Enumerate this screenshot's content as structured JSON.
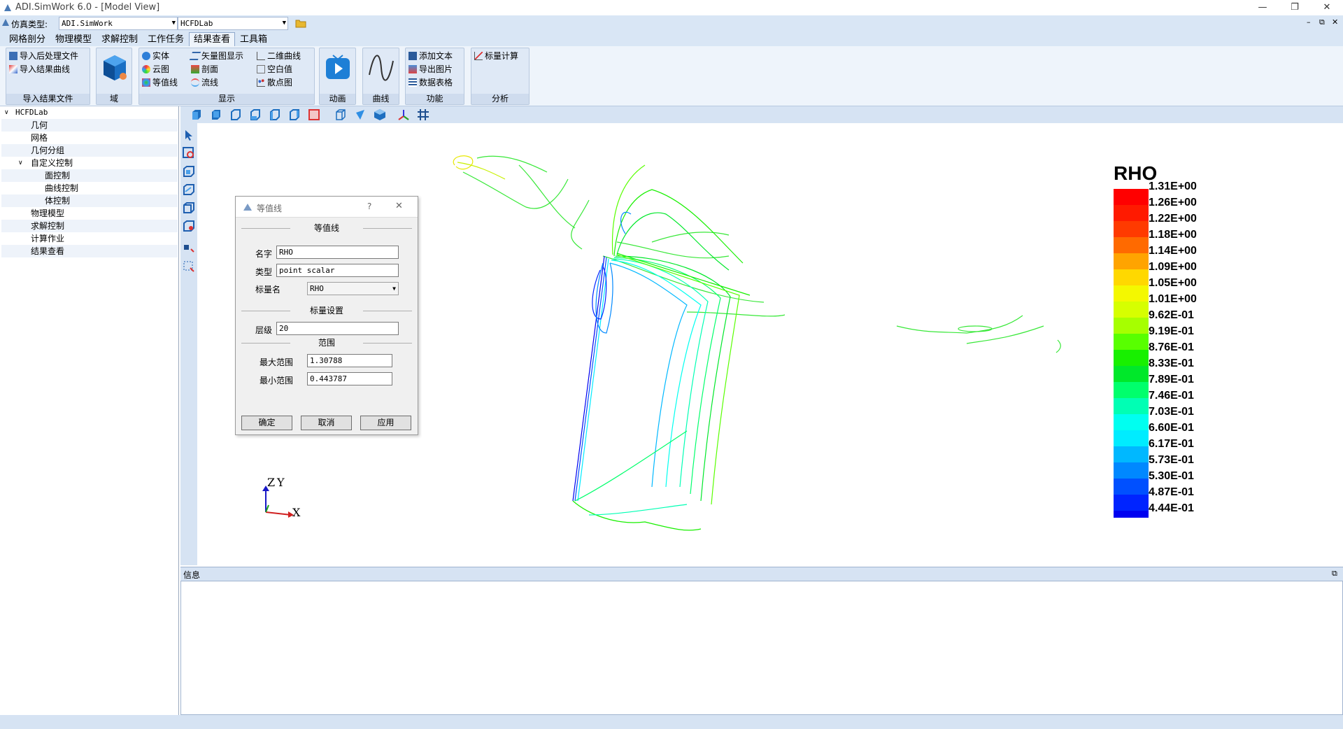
{
  "window": {
    "title": "ADI.SimWork 6.0 - [Model View]",
    "minimize": "—",
    "restore": "❐",
    "close": "✕",
    "sub_min": "–",
    "sub_restore": "⧉",
    "sub_close": "✕"
  },
  "sim_row": {
    "label": "仿真类型:",
    "type_value": "ADI.SimWork",
    "case_value": "HCFDLab"
  },
  "menu_tabs": [
    "网格剖分",
    "物理模型",
    "求解控制",
    "工作任务",
    "结果查看",
    "工具箱"
  ],
  "ribbon": {
    "import_group": {
      "label": "导入结果文件",
      "items": [
        "导入后处理文件",
        "导入结果曲线"
      ]
    },
    "domain_group": {
      "label": "域"
    },
    "display_group": {
      "label": "显示",
      "items": [
        "实体",
        "云图",
        "等值线",
        "矢量图显示",
        "剖面",
        "流线",
        "二维曲线",
        "空白值",
        "散点图"
      ]
    },
    "animation_group": {
      "label": "动画"
    },
    "curve_group": {
      "label": "曲线"
    },
    "function_group": {
      "label": "功能",
      "items": [
        "添加文本",
        "导出图片",
        "数据表格"
      ]
    },
    "analysis_group": {
      "label": "分析",
      "items": [
        "标量计算"
      ]
    }
  },
  "tree": {
    "root": "HCFDLab",
    "items": [
      "几何",
      "网格",
      "几何分组",
      "自定义控制",
      "面控制",
      "曲线控制",
      "体控制",
      "物理模型",
      "求解控制",
      "计算作业",
      "结果查看"
    ]
  },
  "dialog": {
    "title": "等值线",
    "help": "?",
    "close": "✕",
    "section1": "等值线",
    "name_label": "名字",
    "name_value": "RHO",
    "type_label": "类型",
    "type_value": "point scalar",
    "scalar_label": "标量名",
    "scalar_value": "RHO",
    "section2": "标量设置",
    "level_label": "层级",
    "level_value": "20",
    "section3": "范围",
    "max_label": "最大范围",
    "max_value": "1.30788",
    "min_label": "最小范围",
    "min_value": "0.443787",
    "ok": "确定",
    "cancel": "取消",
    "apply": "应用"
  },
  "axes": {
    "z": "Z",
    "y": "Y",
    "x": "X"
  },
  "legend": {
    "title": "RHO",
    "labels": [
      "1.31E+00",
      "1.26E+00",
      "1.22E+00",
      "1.18E+00",
      "1.14E+00",
      "1.09E+00",
      "1.05E+00",
      "1.01E+00",
      "9.62E-01",
      "9.19E-01",
      "8.76E-01",
      "8.33E-01",
      "7.89E-01",
      "7.46E-01",
      "7.03E-01",
      "6.60E-01",
      "6.17E-01",
      "5.73E-01",
      "5.30E-01",
      "4.87E-01",
      "4.44E-01"
    ],
    "colors": [
      "#ff0000",
      "#ff1a00",
      "#ff3a00",
      "#ff6a00",
      "#ffa400",
      "#ffd800",
      "#f4f800",
      "#d6ff00",
      "#a6ff00",
      "#58ff00",
      "#18f000",
      "#00e82a",
      "#00ff6c",
      "#00ffb4",
      "#00fff0",
      "#00ecff",
      "#00b8ff",
      "#0088ff",
      "#0050ff",
      "#0024ff",
      "#0000f0"
    ]
  },
  "info": {
    "title": "信息",
    "restore": "⧉"
  }
}
